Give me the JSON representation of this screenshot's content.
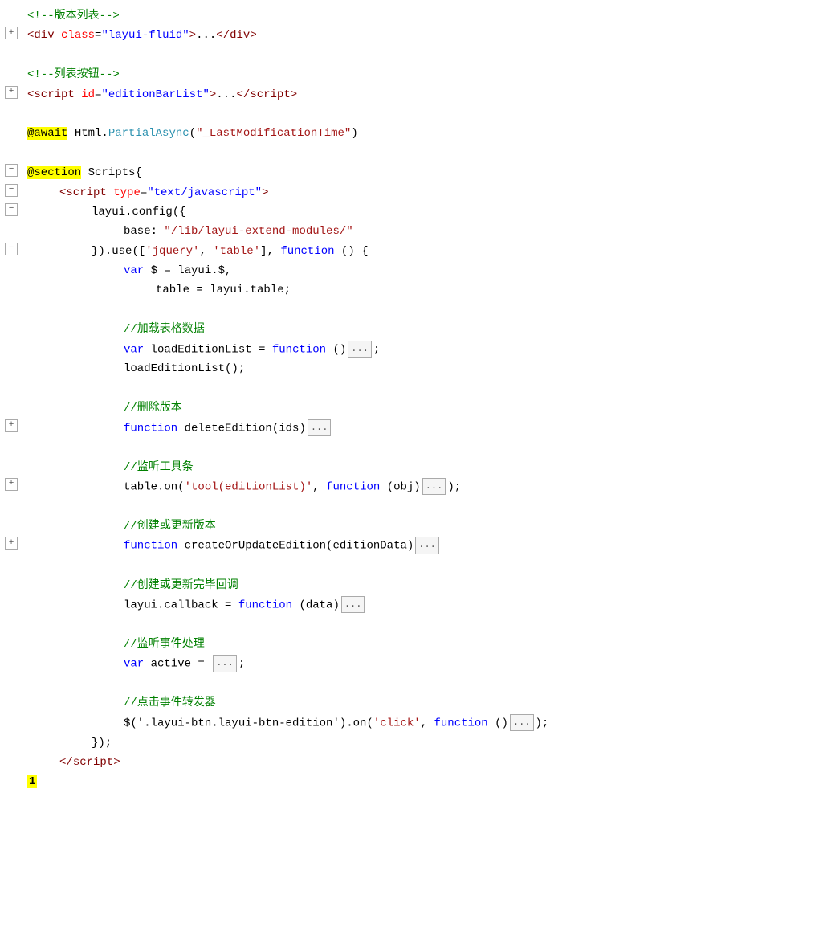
{
  "editor": {
    "lines": [
      {
        "id": 1,
        "hasFold": false,
        "foldState": null,
        "indent": 0,
        "segments": [
          {
            "text": "<!--",
            "class": "c-comment"
          },
          {
            "text": "版本列表",
            "class": "c-comment"
          },
          {
            "text": "-->",
            "class": "c-comment"
          }
        ]
      },
      {
        "id": 2,
        "hasFold": true,
        "foldState": "collapsed",
        "indent": 0,
        "segments": [
          {
            "text": "<",
            "class": "c-tag"
          },
          {
            "text": "div",
            "class": "c-tag"
          },
          {
            "text": " ",
            "class": "c-plain"
          },
          {
            "text": "class",
            "class": "c-attr"
          },
          {
            "text": "=",
            "class": "c-plain"
          },
          {
            "text": "\"layui-fluid\"",
            "class": "c-attrval"
          },
          {
            "text": ">",
            "class": "c-tag"
          },
          {
            "text": "...",
            "class": "c-plain"
          },
          {
            "text": "</",
            "class": "c-tag"
          },
          {
            "text": "div",
            "class": "c-tag"
          },
          {
            "text": ">",
            "class": "c-tag"
          }
        ]
      },
      {
        "id": 3,
        "hasFold": false,
        "foldState": null,
        "indent": 0,
        "segments": [],
        "empty": true
      },
      {
        "id": 4,
        "hasFold": false,
        "foldState": null,
        "indent": 0,
        "segments": [
          {
            "text": "<!--",
            "class": "c-comment"
          },
          {
            "text": "列表按钮",
            "class": "c-comment"
          },
          {
            "text": "-->",
            "class": "c-comment"
          }
        ]
      },
      {
        "id": 5,
        "hasFold": true,
        "foldState": "collapsed",
        "indent": 0,
        "segments": [
          {
            "text": "<",
            "class": "c-tag"
          },
          {
            "text": "script",
            "class": "c-tag"
          },
          {
            "text": " ",
            "class": "c-plain"
          },
          {
            "text": "id",
            "class": "c-attr"
          },
          {
            "text": "=",
            "class": "c-plain"
          },
          {
            "text": "\"editionBarList\"",
            "class": "c-attrval"
          },
          {
            "text": ">",
            "class": "c-tag"
          },
          {
            "text": "...",
            "class": "c-plain"
          },
          {
            "text": "</",
            "class": "c-tag"
          },
          {
            "text": "script",
            "class": "c-tag"
          },
          {
            "text": ">",
            "class": "c-tag"
          }
        ]
      },
      {
        "id": 6,
        "hasFold": false,
        "foldState": null,
        "indent": 0,
        "segments": [],
        "empty": true
      },
      {
        "id": 7,
        "hasFold": false,
        "foldState": null,
        "indent": 0,
        "segments": [
          {
            "text": "@await",
            "class": "c-razor"
          },
          {
            "text": " Html.",
            "class": "c-plain"
          },
          {
            "text": "PartialAsync",
            "class": "c-cyan"
          },
          {
            "text": "(",
            "class": "c-plain"
          },
          {
            "text": "\"_LastModificationTime\"",
            "class": "c-string"
          },
          {
            "text": ")",
            "class": "c-plain"
          }
        ]
      },
      {
        "id": 8,
        "hasFold": false,
        "foldState": null,
        "indent": 0,
        "segments": [],
        "empty": true
      },
      {
        "id": 9,
        "hasFold": true,
        "foldState": "open",
        "indent": 0,
        "segments": [
          {
            "text": "@section",
            "class": "c-razor"
          },
          {
            "text": " Scripts",
            "class": "c-plain"
          },
          {
            "text": "{",
            "class": "c-plain"
          }
        ]
      },
      {
        "id": 10,
        "hasFold": true,
        "foldState": "open",
        "indent": 1,
        "segments": [
          {
            "text": "<",
            "class": "c-tag"
          },
          {
            "text": "script",
            "class": "c-tag"
          },
          {
            "text": " ",
            "class": "c-plain"
          },
          {
            "text": "type",
            "class": "c-attr"
          },
          {
            "text": "=",
            "class": "c-plain"
          },
          {
            "text": "\"text/javascript\"",
            "class": "c-attrval"
          },
          {
            "text": ">",
            "class": "c-tag"
          }
        ]
      },
      {
        "id": 11,
        "hasFold": true,
        "foldState": "open",
        "indent": 2,
        "segments": [
          {
            "text": "layui",
            "class": "c-plain"
          },
          {
            "text": ".",
            "class": "c-plain"
          },
          {
            "text": "config",
            "class": "c-plain"
          },
          {
            "text": "({",
            "class": "c-plain"
          }
        ]
      },
      {
        "id": 12,
        "hasFold": false,
        "foldState": null,
        "indent": 3,
        "segments": [
          {
            "text": "base",
            "class": "c-plain"
          },
          {
            "text": ": ",
            "class": "c-plain"
          },
          {
            "text": "\"/lib/layui-extend-modules/\"",
            "class": "c-string"
          }
        ]
      },
      {
        "id": 13,
        "hasFold": true,
        "foldState": "open",
        "indent": 2,
        "segments": [
          {
            "text": "}).",
            "class": "c-plain"
          },
          {
            "text": "use",
            "class": "c-plain"
          },
          {
            "text": "([",
            "class": "c-plain"
          },
          {
            "text": "'jquery'",
            "class": "c-string"
          },
          {
            "text": ", ",
            "class": "c-plain"
          },
          {
            "text": "'table'",
            "class": "c-string"
          },
          {
            "text": "], ",
            "class": "c-plain"
          },
          {
            "text": "function",
            "class": "c-blue"
          },
          {
            "text": " () {",
            "class": "c-plain"
          }
        ]
      },
      {
        "id": 14,
        "hasFold": false,
        "foldState": null,
        "indent": 3,
        "segments": [
          {
            "text": "var",
            "class": "c-blue"
          },
          {
            "text": " $ = layui.$,",
            "class": "c-plain"
          }
        ]
      },
      {
        "id": 15,
        "hasFold": false,
        "foldState": null,
        "indent": 4,
        "segments": [
          {
            "text": "table = layui.table;",
            "class": "c-plain"
          }
        ]
      },
      {
        "id": 16,
        "hasFold": false,
        "foldState": null,
        "indent": 0,
        "segments": [],
        "empty": true
      },
      {
        "id": 17,
        "hasFold": false,
        "foldState": null,
        "indent": 3,
        "segments": [
          {
            "text": "//加载表格数据",
            "class": "c-green-comment"
          }
        ]
      },
      {
        "id": 18,
        "hasFold": false,
        "foldState": null,
        "indent": 3,
        "segments": [
          {
            "text": "var",
            "class": "c-blue"
          },
          {
            "text": " loadEditionList = ",
            "class": "c-plain"
          },
          {
            "text": "function",
            "class": "c-blue"
          },
          {
            "text": " ()",
            "class": "c-plain"
          },
          {
            "text": "...",
            "class": "c-collapsed"
          },
          {
            "text": ";",
            "class": "c-plain"
          }
        ]
      },
      {
        "id": 19,
        "hasFold": false,
        "foldState": null,
        "indent": 3,
        "segments": [
          {
            "text": "loadEditionList();",
            "class": "c-plain"
          }
        ]
      },
      {
        "id": 20,
        "hasFold": false,
        "foldState": null,
        "indent": 0,
        "segments": [],
        "empty": true
      },
      {
        "id": 21,
        "hasFold": false,
        "foldState": null,
        "indent": 3,
        "segments": [
          {
            "text": "//删除版本",
            "class": "c-green-comment"
          }
        ]
      },
      {
        "id": 22,
        "hasFold": true,
        "foldState": "collapsed-inline",
        "indent": 3,
        "segments": [
          {
            "text": "function",
            "class": "c-blue"
          },
          {
            "text": " deleteEdition(ids)",
            "class": "c-plain"
          },
          {
            "text": "...",
            "class": "c-collapsed"
          }
        ]
      },
      {
        "id": 23,
        "hasFold": false,
        "foldState": null,
        "indent": 0,
        "segments": [],
        "empty": true
      },
      {
        "id": 24,
        "hasFold": false,
        "foldState": null,
        "indent": 3,
        "segments": [
          {
            "text": "//监听工具条",
            "class": "c-green-comment"
          }
        ]
      },
      {
        "id": 25,
        "hasFold": true,
        "foldState": "collapsed-inline",
        "indent": 3,
        "segments": [
          {
            "text": "table.on(",
            "class": "c-plain"
          },
          {
            "text": "'tool(editionList)'",
            "class": "c-string"
          },
          {
            "text": ", ",
            "class": "c-plain"
          },
          {
            "text": "function",
            "class": "c-blue"
          },
          {
            "text": " (obj)",
            "class": "c-plain"
          },
          {
            "text": "...",
            "class": "c-collapsed"
          },
          {
            "text": ");",
            "class": "c-plain"
          }
        ]
      },
      {
        "id": 26,
        "hasFold": false,
        "foldState": null,
        "indent": 0,
        "segments": [],
        "empty": true
      },
      {
        "id": 27,
        "hasFold": false,
        "foldState": null,
        "indent": 3,
        "segments": [
          {
            "text": "//创建或更新版本",
            "class": "c-green-comment"
          }
        ]
      },
      {
        "id": 28,
        "hasFold": true,
        "foldState": "collapsed-inline",
        "indent": 3,
        "segments": [
          {
            "text": "function",
            "class": "c-blue"
          },
          {
            "text": " createOrUpdateEdition(editionData)",
            "class": "c-plain"
          },
          {
            "text": "...",
            "class": "c-collapsed"
          }
        ]
      },
      {
        "id": 29,
        "hasFold": false,
        "foldState": null,
        "indent": 0,
        "segments": [],
        "empty": true
      },
      {
        "id": 30,
        "hasFold": false,
        "foldState": null,
        "indent": 3,
        "segments": [
          {
            "text": "//创建或更新完毕回调",
            "class": "c-green-comment"
          }
        ]
      },
      {
        "id": 31,
        "hasFold": false,
        "foldState": null,
        "indent": 3,
        "segments": [
          {
            "text": "layui.callback = ",
            "class": "c-plain"
          },
          {
            "text": "function",
            "class": "c-blue"
          },
          {
            "text": " (data)",
            "class": "c-plain"
          },
          {
            "text": "...",
            "class": "c-collapsed"
          },
          {
            "text": "",
            "class": "c-plain"
          }
        ]
      },
      {
        "id": 32,
        "hasFold": false,
        "foldState": null,
        "indent": 0,
        "segments": [],
        "empty": true
      },
      {
        "id": 33,
        "hasFold": false,
        "foldState": null,
        "indent": 3,
        "segments": [
          {
            "text": "//监听事件处理",
            "class": "c-green-comment"
          }
        ]
      },
      {
        "id": 34,
        "hasFold": false,
        "foldState": null,
        "indent": 3,
        "segments": [
          {
            "text": "var",
            "class": "c-blue"
          },
          {
            "text": " active = ",
            "class": "c-plain"
          },
          {
            "text": "...",
            "class": "c-collapsed"
          },
          {
            "text": ";",
            "class": "c-plain"
          }
        ]
      },
      {
        "id": 35,
        "hasFold": false,
        "foldState": null,
        "indent": 0,
        "segments": [],
        "empty": true
      },
      {
        "id": 36,
        "hasFold": false,
        "foldState": null,
        "indent": 3,
        "segments": [
          {
            "text": "//点击事件转发器",
            "class": "c-green-comment"
          }
        ]
      },
      {
        "id": 37,
        "hasFold": false,
        "foldState": null,
        "indent": 3,
        "segments": [
          {
            "text": "$('.layui-btn.layui-btn-edition').on(",
            "class": "c-plain"
          },
          {
            "text": "'click'",
            "class": "c-string"
          },
          {
            "text": ", ",
            "class": "c-plain"
          },
          {
            "text": "function",
            "class": "c-blue"
          },
          {
            "text": " ()",
            "class": "c-plain"
          },
          {
            "text": "...",
            "class": "c-collapsed"
          },
          {
            "text": ");",
            "class": "c-plain"
          }
        ]
      },
      {
        "id": 38,
        "hasFold": false,
        "foldState": null,
        "indent": 2,
        "segments": [
          {
            "text": "});",
            "class": "c-plain"
          }
        ]
      },
      {
        "id": 39,
        "hasFold": false,
        "foldState": null,
        "indent": 1,
        "segments": [
          {
            "text": "</",
            "class": "c-tag"
          },
          {
            "text": "script",
            "class": "c-tag"
          },
          {
            "text": ">",
            "class": "c-tag"
          }
        ]
      }
    ],
    "footer_num": "1",
    "footer_num_bg": "#ffff00"
  }
}
